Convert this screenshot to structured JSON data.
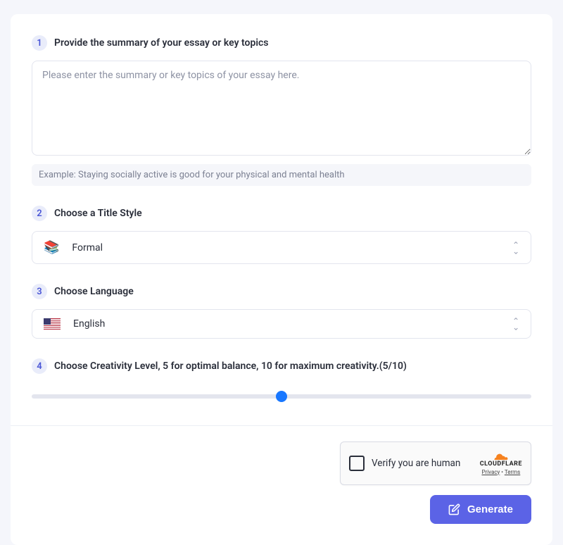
{
  "step1": {
    "num": "1",
    "label": "Provide the summary of your essay or key topics",
    "placeholder": "Please enter the summary or key topics of your essay here.",
    "example": "Example:  Staying socially active is good for your physical and mental health"
  },
  "step2": {
    "num": "2",
    "label": "Choose a Title Style",
    "icon": "📚",
    "value": "Formal"
  },
  "step3": {
    "num": "3",
    "label": "Choose Language",
    "value": "English"
  },
  "step4": {
    "num": "4",
    "label": "Choose Creativity Level, 5 for optimal balance, 10 for maximum creativity.(5/10)",
    "value": 5,
    "min": 0,
    "max": 10
  },
  "captcha": {
    "text": "Verify you are human",
    "brand": "CLOUDFLARE",
    "privacy": "Privacy",
    "terms": "Terms"
  },
  "generate": {
    "label": "Generate"
  },
  "chart_data": null
}
